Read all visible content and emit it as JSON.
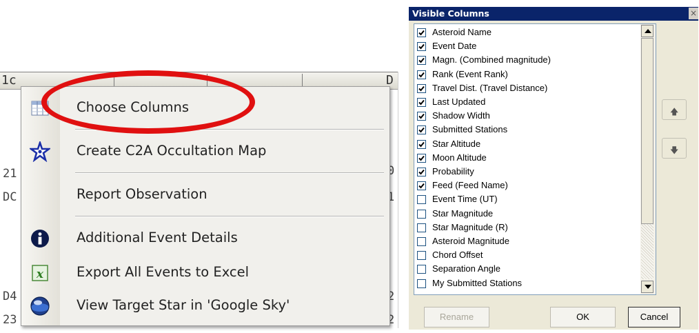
{
  "grid": {
    "header_cells": [
      "1c",
      "D"
    ],
    "fragments": [
      "21",
      "0",
      "DC",
      "1",
      "D4",
      "2",
      "23",
      "2"
    ]
  },
  "context_menu": {
    "items": [
      {
        "label": "Choose Columns",
        "icon": "columns-icon"
      },
      {
        "label": "Create C2A Occultation Map",
        "icon": "star-map-icon"
      },
      {
        "label": "Report Observation",
        "icon": ""
      },
      {
        "label": "Additional Event Details",
        "icon": "info-icon"
      },
      {
        "label": "Export All Events to Excel",
        "icon": "excel-icon"
      },
      {
        "label": "View Target Star in 'Google Sky'",
        "icon": "google-sky-icon"
      }
    ]
  },
  "dialog": {
    "title": "Visible Columns",
    "close_glyph": "×",
    "columns": [
      {
        "label": "Asteroid Name",
        "checked": true
      },
      {
        "label": "Event Date",
        "checked": true
      },
      {
        "label": "Magn. (Combined magnitude)",
        "checked": true
      },
      {
        "label": "Rank (Event Rank)",
        "checked": true
      },
      {
        "label": "Travel Dist. (Travel Distance)",
        "checked": true
      },
      {
        "label": "Last Updated",
        "checked": true
      },
      {
        "label": "Shadow Width",
        "checked": true
      },
      {
        "label": "Submitted Stations",
        "checked": true
      },
      {
        "label": "Star Altitude",
        "checked": true
      },
      {
        "label": "Moon Altitude",
        "checked": true
      },
      {
        "label": "Probability",
        "checked": true
      },
      {
        "label": "Feed (Feed Name)",
        "checked": true
      },
      {
        "label": "Event Time (UT)",
        "checked": false
      },
      {
        "label": "Star Magnitude",
        "checked": false
      },
      {
        "label": "Star Magnitude (R)",
        "checked": false
      },
      {
        "label": "Asteroid Magnitude",
        "checked": false
      },
      {
        "label": "Chord Offset",
        "checked": false
      },
      {
        "label": "Separation Angle",
        "checked": false
      },
      {
        "label": "My Submitted Stations",
        "checked": false
      }
    ],
    "move_up_glyph": "🡅",
    "move_down_glyph": "🡇",
    "buttons": {
      "rename": "Rename",
      "ok": "OK",
      "cancel": "Cancel"
    }
  },
  "colors": {
    "highlight_ring": "#e01010",
    "title_bar": "#0a246a",
    "dialog_face": "#ece9d8"
  }
}
